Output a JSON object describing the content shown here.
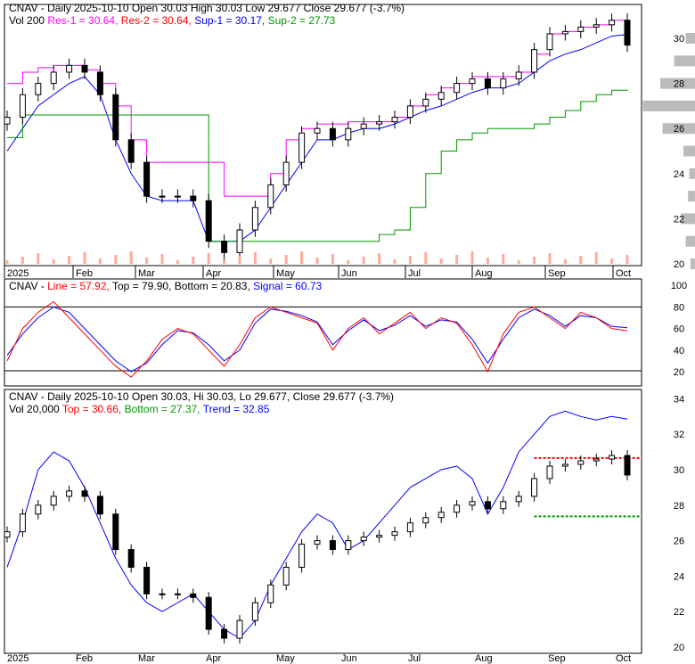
{
  "panel1": {
    "line1": [
      "CNAV - Daily 2025-10-10 Open 30.03  High 30.03  Low 29.677  Close 29.677 (-3.7%)"
    ],
    "vol": "Vol 200 ",
    "res1": "Res-1 = 30.64,",
    "res2": "Res-2 = 30.64,",
    "sup1": "Sup-1 = 30.17,",
    "sup2": "Sup-2 = 27.73",
    "title": "CNAV - Daily 2025-10-10 Open 30.03  High 30.03  Low 29.677  Close 29.677 (-3.7%)"
  },
  "panel2": {
    "name": "CNAV - ",
    "line": "Line = 57.92,",
    "top": "Top = 79.90,",
    "bottom": "Bottom = 20.83,",
    "signal": "Signal = 60.73"
  },
  "panel3": {
    "title": "CNAV - Daily 2025-10-10 Open 30.03, Hi 30.03, Lo 29.677, Close 29.677 (-3.7%)",
    "vol": "Vol 20,000 ",
    "top": "Top = 30.66,",
    "bottom": "Bottom = 27.37,",
    "trend": "Trend = 32.85"
  },
  "colors": {
    "res1": "#ff00ff",
    "res2": "#ff0000",
    "sup1": "#0000ff",
    "sup2": "#009900",
    "volume": "#ffaa99",
    "vbp": "#bbbbbb"
  },
  "chart_data": {
    "type": "candlestick",
    "x_labels": [
      "2025",
      "Feb",
      "Mar",
      "Apr",
      "May",
      "Jun",
      "Jul",
      "Aug",
      "Sep",
      "Oct"
    ],
    "price_ticks": [
      20,
      22,
      24,
      26,
      28,
      30
    ],
    "panel3_ticks": [
      20,
      22,
      24,
      26,
      28,
      30,
      32,
      34
    ],
    "osc_ticks": [
      20,
      40,
      60,
      80,
      100
    ],
    "close": [
      26.5,
      27.5,
      28.0,
      28.5,
      28.8,
      28.5,
      27.5,
      25.5,
      24.5,
      23.0,
      23.0,
      23.0,
      22.8,
      21.0,
      20.5,
      21.5,
      22.5,
      23.5,
      24.5,
      25.8,
      26.0,
      25.5,
      26.0,
      26.2,
      26.3,
      26.5,
      27.0,
      27.3,
      27.6,
      28.0,
      28.2,
      27.8,
      28.2,
      28.5,
      29.5,
      30.2,
      30.3,
      30.5,
      30.6,
      30.8,
      29.7
    ],
    "res1": [
      28,
      28.5,
      28.7,
      28.8,
      28.8,
      28.6,
      28.0,
      27.0,
      25.5,
      24.5,
      24.5,
      24.5,
      24.5,
      24.5,
      23.0,
      23.0,
      23.0,
      24.0,
      25.5,
      26.0,
      26.2,
      26.2,
      26.3,
      26.3,
      26.3,
      26.5,
      27.0,
      27.5,
      27.8,
      28.0,
      28.3,
      28.3,
      28.3,
      28.5,
      29.3,
      30.2,
      30.3,
      30.5,
      30.6,
      30.8,
      30.8
    ],
    "sup1": [
      25,
      26,
      27,
      27.5,
      28,
      28.3,
      27.5,
      25.5,
      24,
      23,
      22.8,
      22.8,
      22.8,
      21.0,
      21.0,
      21.0,
      21.5,
      22.5,
      23.5,
      24.5,
      25.5,
      25.5,
      25.8,
      26.0,
      26.0,
      26.2,
      26.5,
      26.8,
      27.0,
      27.3,
      27.6,
      27.8,
      27.8,
      28.0,
      28.5,
      29.0,
      29.3,
      29.5,
      29.8,
      30.1,
      30.17
    ],
    "sup2": [
      25.6,
      26.6,
      26.6,
      26.6,
      26.6,
      26.6,
      26.6,
      26.6,
      26.6,
      26.6,
      26.6,
      26.6,
      26.6,
      21.0,
      21.0,
      21.0,
      21.0,
      21.0,
      21.0,
      21.0,
      21.0,
      21.0,
      21.0,
      21.0,
      21.3,
      21.5,
      22.5,
      24.0,
      25.0,
      25.5,
      25.8,
      26.0,
      26.0,
      26.0,
      26.2,
      26.5,
      26.8,
      27.2,
      27.5,
      27.7,
      27.73
    ],
    "osc_line": [
      30,
      60,
      75,
      85,
      70,
      55,
      40,
      25,
      15,
      30,
      50,
      60,
      55,
      40,
      25,
      45,
      70,
      80,
      75,
      70,
      65,
      40,
      60,
      70,
      55,
      65,
      75,
      60,
      70,
      65,
      45,
      20,
      55,
      75,
      80,
      70,
      60,
      75,
      70,
      60,
      57.92
    ],
    "osc_signal": [
      35,
      55,
      70,
      80,
      75,
      60,
      45,
      30,
      20,
      28,
      45,
      58,
      56,
      45,
      30,
      40,
      65,
      78,
      76,
      72,
      66,
      45,
      58,
      68,
      58,
      63,
      72,
      62,
      68,
      66,
      50,
      28,
      50,
      70,
      78,
      72,
      62,
      72,
      70,
      62,
      60.73
    ],
    "trend": [
      24.5,
      27,
      30,
      31,
      30.5,
      29,
      27,
      25,
      23.5,
      22.5,
      22,
      22.5,
      23,
      22,
      21,
      20.5,
      21.5,
      23.5,
      25,
      26.5,
      27.5,
      27,
      25.5,
      26,
      27,
      28,
      29,
      29.5,
      30,
      30.2,
      29.5,
      27.5,
      29,
      31,
      32,
      33,
      33.3,
      33,
      32.8,
      33,
      32.85
    ],
    "vbp": [
      [
        20,
        4
      ],
      [
        21,
        8
      ],
      [
        22,
        12
      ],
      [
        23,
        6
      ],
      [
        24,
        5
      ],
      [
        25,
        10
      ],
      [
        26,
        28
      ],
      [
        27,
        45
      ],
      [
        28,
        30
      ],
      [
        29,
        18
      ],
      [
        30,
        8
      ]
    ]
  }
}
